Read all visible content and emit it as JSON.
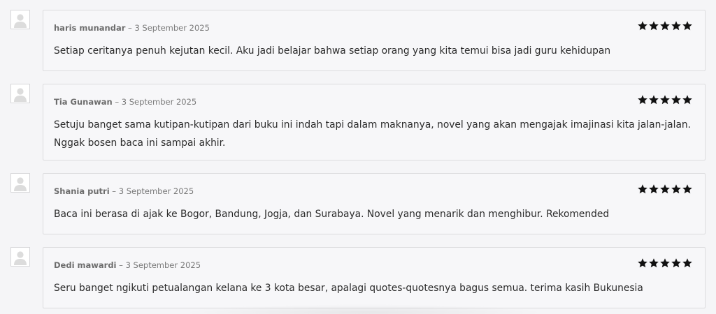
{
  "reviews": [
    {
      "author": "haris munandar",
      "separator": " – ",
      "date": "3 September 2025",
      "rating": 5,
      "text": "Setiap ceritanya penuh kejutan kecil. Aku jadi belajar bahwa setiap orang yang kita temui bisa jadi guru kehidupan"
    },
    {
      "author": "Tia Gunawan",
      "separator": " – ",
      "date": "3 September 2025",
      "rating": 5,
      "text": "Setuju banget sama kutipan-kutipan dari buku ini indah tapi dalam maknanya, novel yang akan mengajak imajinasi kita jalan-jalan. Nggak bosen baca ini sampai akhir."
    },
    {
      "author": "Shania putri",
      "separator": " – ",
      "date": "3 September 2025",
      "rating": 5,
      "text": "Baca ini berasa di ajak ke Bogor, Bandung, Jogja, dan Surabaya. Novel yang menarik dan menghibur. Rekomended"
    },
    {
      "author": "Dedi mawardi",
      "separator": " – ",
      "date": "3 September 2025",
      "rating": 5,
      "text": "Seru banget ngikuti petualangan kelana ke 3 kota besar, apalagi quotes-quotesnya bagus semua. terima kasih Bukunesia"
    }
  ],
  "icons": {
    "avatar": "default-avatar-icon",
    "star": "star-icon"
  },
  "colors": {
    "star": "#111111",
    "card_bg": "#f7f7f9",
    "card_border": "#dcdcde",
    "avatar_figure": "#dcdcdc"
  }
}
